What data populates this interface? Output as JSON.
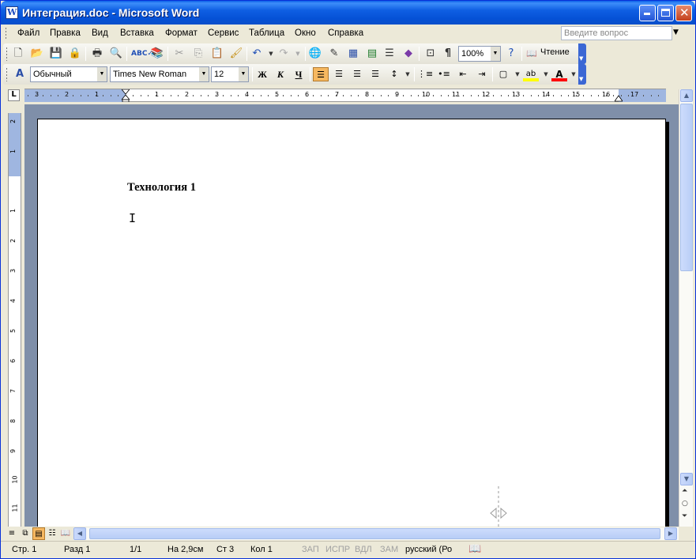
{
  "window": {
    "title": "Интеграция.doc - Microsoft Word",
    "app_icon_letter": "W"
  },
  "menu": {
    "items": [
      "Файл",
      "Правка",
      "Вид",
      "Вставка",
      "Формат",
      "Сервис",
      "Таблица",
      "Окно",
      "Справка"
    ],
    "help_placeholder": "Введите вопрос"
  },
  "standard_toolbar": {
    "zoom": "100%",
    "reading_label": "Чтение",
    "icons": [
      "new-document-icon",
      "open-folder-icon",
      "save-icon",
      "permission-icon",
      "print-icon",
      "print-preview-icon",
      "spelling-icon",
      "research-icon",
      "cut-icon",
      "copy-icon",
      "paste-icon",
      "format-painter-icon",
      "undo-icon",
      "redo-icon",
      "hyperlink-icon",
      "tables-borders-icon",
      "insert-table-icon",
      "insert-excel-icon",
      "columns-icon",
      "drawing-icon",
      "document-map-icon",
      "show-formatting-icon",
      "help-icon"
    ]
  },
  "formatting_toolbar": {
    "style": "Обычный",
    "font": "Times New Roman",
    "size": "12",
    "bold_label": "Ж",
    "italic_label": "К",
    "underline_label": "Ч",
    "active_alignment": "align-left",
    "highlight_color": "#ffff00",
    "font_color": "#ff0000"
  },
  "ruler": {
    "horizontal_numbers": [
      "3",
      "2",
      "1",
      "1",
      "2",
      "3",
      "4",
      "5",
      "6",
      "7",
      "8",
      "9",
      "10",
      "11",
      "12",
      "13",
      "14",
      "15",
      "16",
      "17"
    ],
    "vertical_numbers": [
      "2",
      "1",
      "1",
      "2",
      "3",
      "4",
      "5",
      "6",
      "7",
      "8",
      "9",
      "10",
      "11"
    ]
  },
  "document": {
    "heading": "Технология 1",
    "cursor": "I"
  },
  "status_bar": {
    "page": "Стр. 1",
    "section": "Разд 1",
    "pages": "1/1",
    "position": "На 2,9см",
    "line": "Ст 3",
    "column": "Кол 1",
    "rec": "ЗАП",
    "trk": "ИСПР",
    "ext": "ВДЛ",
    "ovr": "ЗАМ",
    "language": "русский (Ро"
  }
}
